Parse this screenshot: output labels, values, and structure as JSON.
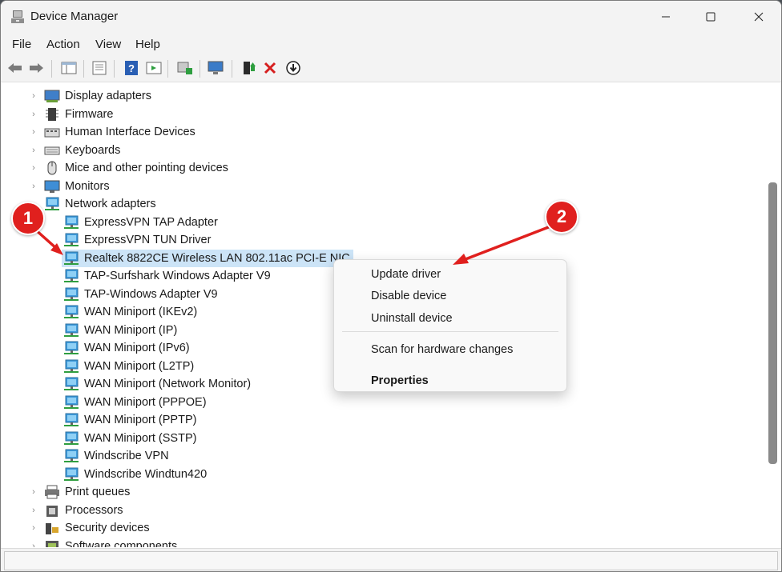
{
  "window": {
    "title": "Device Manager"
  },
  "menu": [
    "File",
    "Action",
    "View",
    "Help"
  ],
  "toolbar": {
    "icons": [
      "back-icon",
      "forward-icon",
      "show-hide-console-tree-icon",
      "properties-icon",
      "help-icon",
      "action-pane-icon",
      "scan-hardware-icon",
      "computer-icon",
      "update-driver-icon",
      "uninstall-icon",
      "disable-icon"
    ]
  },
  "tree": {
    "categories_top": [
      {
        "label": "Display adapters",
        "icon": "display-adapter-icon"
      },
      {
        "label": "Firmware",
        "icon": "firmware-icon"
      },
      {
        "label": "Human Interface Devices",
        "icon": "hid-icon"
      },
      {
        "label": "Keyboards",
        "icon": "keyboard-icon"
      },
      {
        "label": "Mice and other pointing devices",
        "icon": "mouse-icon"
      },
      {
        "label": "Monitors",
        "icon": "monitor-icon"
      }
    ],
    "network": {
      "label": "Network adapters",
      "children": [
        "ExpressVPN TAP Adapter",
        "ExpressVPN TUN Driver",
        "Realtek 8822CE Wireless LAN 802.11ac PCI-E NIC",
        "TAP-Surfshark Windows Adapter V9",
        "TAP-Windows Adapter V9",
        "WAN Miniport (IKEv2)",
        "WAN Miniport (IP)",
        "WAN Miniport (IPv6)",
        "WAN Miniport (L2TP)",
        "WAN Miniport (Network Monitor)",
        "WAN Miniport (PPPOE)",
        "WAN Miniport (PPTP)",
        "WAN Miniport (SSTP)",
        "Windscribe VPN",
        "Windscribe Windtun420"
      ],
      "selected_index": 2
    },
    "categories_bottom": [
      {
        "label": "Print queues",
        "icon": "printer-icon"
      },
      {
        "label": "Processors",
        "icon": "processor-icon"
      },
      {
        "label": "Security devices",
        "icon": "security-device-icon"
      },
      {
        "label": "Software components",
        "icon": "software-component-icon"
      }
    ]
  },
  "context_menu": {
    "update": "Update driver",
    "disable": "Disable device",
    "uninstall": "Uninstall device",
    "scan": "Scan for hardware changes",
    "properties": "Properties"
  },
  "annotations": {
    "step1": "1",
    "step2": "2",
    "color": "#e0201e"
  }
}
